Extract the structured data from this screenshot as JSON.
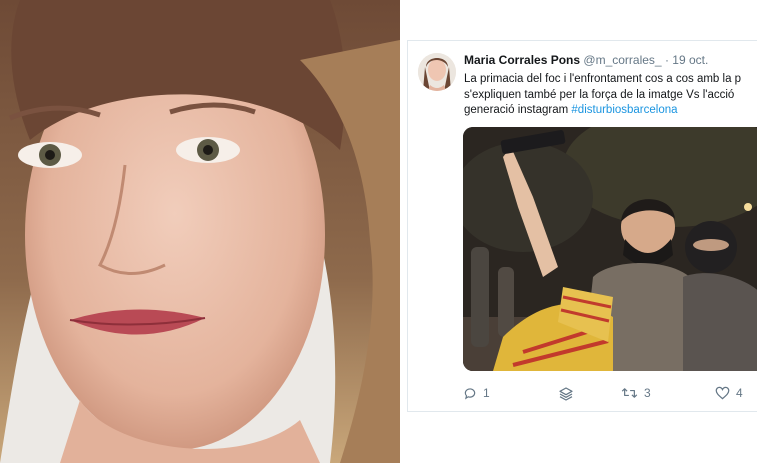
{
  "tweet": {
    "author_name": "Maria Corrales Pons",
    "handle": "@m_corrales_",
    "separator": "·",
    "date": "19 oct.",
    "text_lines": [
      "La primacia del foc i l'enfrontament cos a cos amb la p",
      "s'expliquen també per la força de la imatge Vs l'acció",
      "generació instagram "
    ],
    "hashtag": "#disturbiosbarcelona",
    "actions": {
      "reply_count": "1",
      "retweet_count": "3",
      "like_count": "4"
    }
  },
  "icons": {
    "reply": "reply-icon",
    "stack": "stack-icon",
    "retweet": "retweet-icon",
    "like": "heart-icon"
  },
  "colors": {
    "link": "#1b95e0",
    "muted": "#657786",
    "border": "#e1e8ed"
  }
}
